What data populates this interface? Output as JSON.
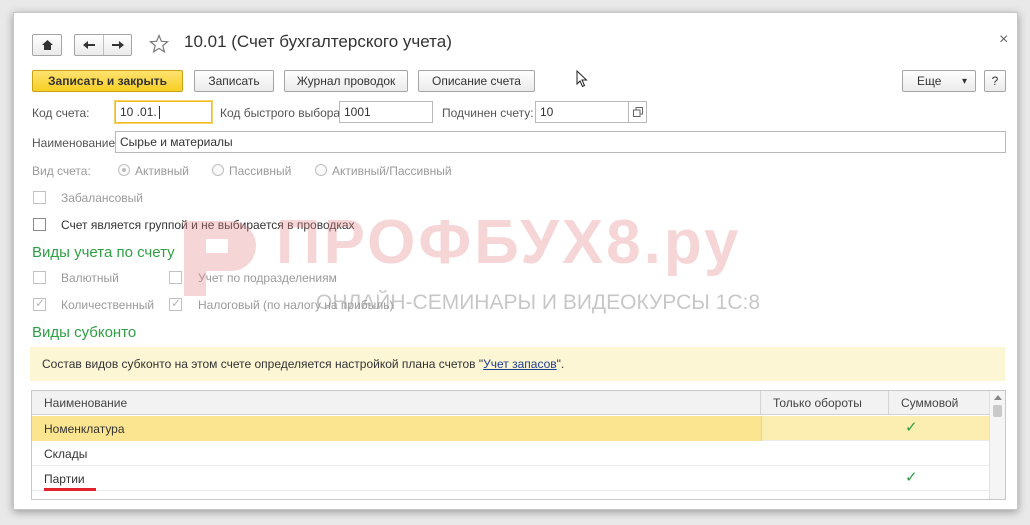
{
  "window": {
    "title": "10.01 (Счет бухгалтерского учета)",
    "close_glyph": "×"
  },
  "toolbar": {
    "save_close": "Записать и закрыть",
    "save": "Записать",
    "journal": "Журнал проводок",
    "description": "Описание счета",
    "more": "Еще",
    "more_arrow": "▾",
    "help": "?"
  },
  "fields": {
    "code_label": "Код счета:",
    "code_value": "10 .01.",
    "quick_label": "Код быстрого выбора:",
    "quick_value": "1001",
    "parent_label": "Подчинен счету:",
    "parent_value": "10",
    "name_label": "Наименование:",
    "name_value": "Сырье и материалы"
  },
  "account_type": {
    "label": "Вид счета:",
    "options": [
      "Активный",
      "Пассивный",
      "Активный/Пассивный"
    ]
  },
  "flags": {
    "off_balance": "Забалансовый",
    "group": "Счет является группой и не выбирается в проводках"
  },
  "accounting": {
    "title": "Виды учета по счету",
    "currency": "Валютный",
    "departments": "Учет по подразделениям",
    "quantity": "Количественный",
    "tax": "Налоговый (по налогу на прибыль)"
  },
  "subconto": {
    "title": "Виды субконто",
    "info_text": "Состав видов субконто на этом счете определяется настройкой плана счетов \"",
    "info_link": "Учет запасов",
    "info_end": "\".",
    "columns": [
      "Наименование",
      "Только обороты",
      "Суммовой"
    ],
    "rows": [
      {
        "name": "Номенклатура",
        "turnover": "",
        "sum": "✓"
      },
      {
        "name": "Склады",
        "turnover": "",
        "sum": ""
      },
      {
        "name": "Партии",
        "turnover": "",
        "sum": "✓"
      }
    ]
  },
  "watermark": {
    "brand": "ПРОФБУХ8.ру",
    "tagline": "ОНЛАЙН-СЕМИНАРЫ И ВИДЕОКУРСЫ 1С:8"
  },
  "colors": {
    "accent_yellow": "#f7cf24",
    "section_green": "#2f9f45",
    "info_bg": "#fcf6d5",
    "watermark_red": "#e8888d",
    "underline_red": "#e0202a"
  },
  "icons": [
    "home-icon",
    "back-arrow-icon",
    "forward-arrow-icon",
    "star-icon",
    "close-icon",
    "open-form-icon",
    "mouse-cursor-icon",
    "checkmark-icon"
  ]
}
